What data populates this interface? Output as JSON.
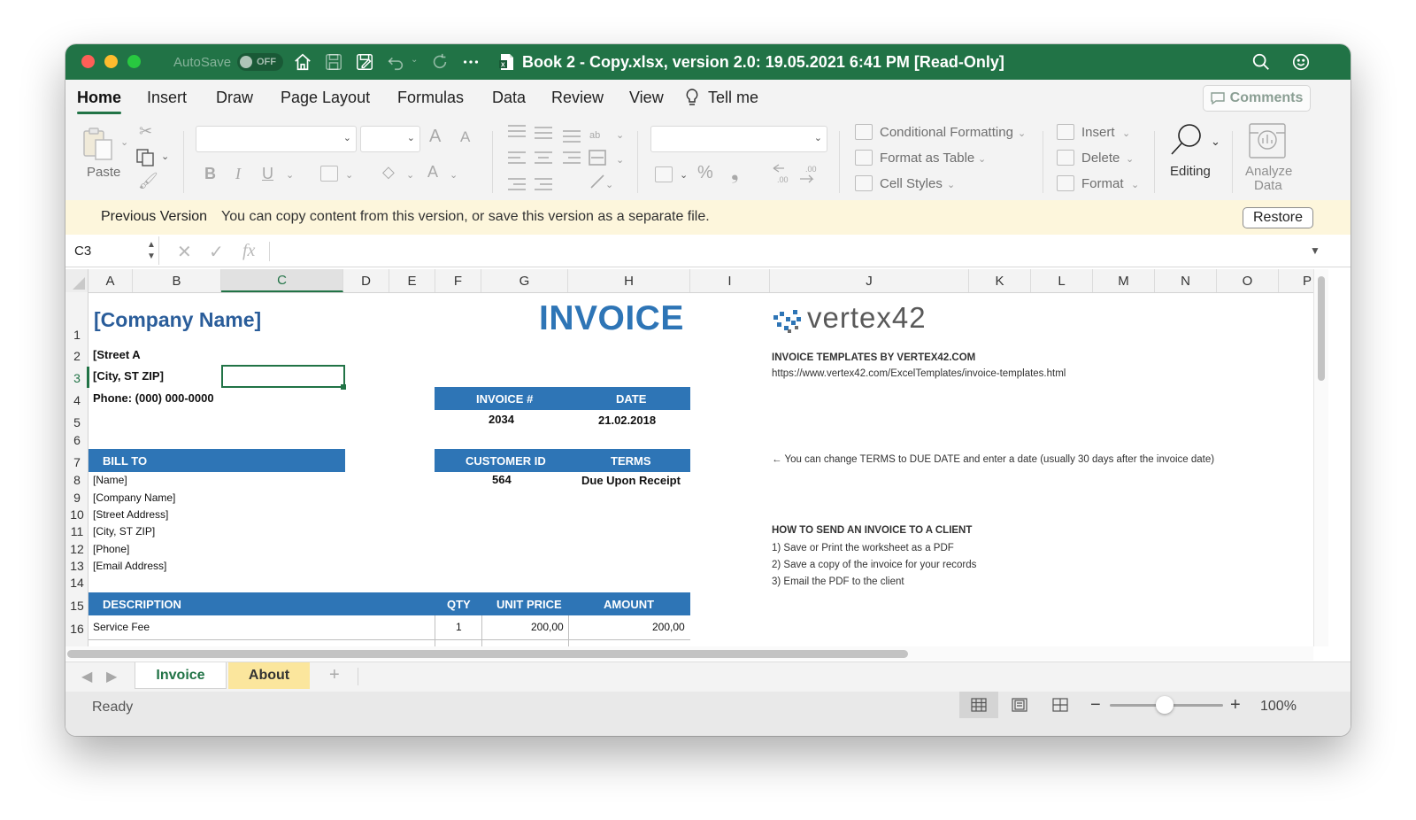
{
  "titlebar": {
    "autosave_label": "AutoSave",
    "autosave_state": "OFF",
    "title": "Book 2 - Copy.xlsx, version 2.0: 19.05.2021 6:41 PM  [Read-Only]"
  },
  "tabs": [
    "Home",
    "Insert",
    "Draw",
    "Page Layout",
    "Formulas",
    "Data",
    "Review",
    "View"
  ],
  "tell_me": "Tell me",
  "comments_label": "Comments",
  "ribbon": {
    "paste": "Paste",
    "conditional_formatting": "Conditional Formatting",
    "format_as_table": "Format as Table",
    "cell_styles": "Cell Styles",
    "insert": "Insert",
    "delete": "Delete",
    "format": "Format",
    "editing": "Editing",
    "analyze_data_1": "Analyze",
    "analyze_data_2": "Data",
    "font_increase": "A",
    "font_decrease": "A",
    "bold": "B",
    "italic": "I",
    "underline": "U",
    "percent": "%",
    "comma": "❟",
    "font_color": "A"
  },
  "message_bar": {
    "title": "Previous Version",
    "text": "You can copy content from this version, or save this version as a separate file.",
    "restore": "Restore"
  },
  "formula_bar": {
    "name_box": "C3",
    "formula": ""
  },
  "columns": [
    "A",
    "B",
    "C",
    "D",
    "E",
    "F",
    "G",
    "H",
    "I",
    "J",
    "K",
    "L",
    "M",
    "N",
    "O",
    "P"
  ],
  "rows": [
    "1",
    "2",
    "3",
    "4",
    "5",
    "6",
    "7",
    "8",
    "9",
    "10",
    "11",
    "12",
    "13",
    "14",
    "15",
    "16"
  ],
  "sheet": {
    "company_name": "[Company Name]",
    "street": "[Street A",
    "city": "[City, ST  ZIP]",
    "phone": "Phone: (000) 000-0000",
    "invoice_title": "INVOICE",
    "invoice_no_label": "INVOICE #",
    "date_label": "DATE",
    "invoice_no": "2034",
    "date": "21.02.2018",
    "bill_to": "BILL TO",
    "customer_id_label": "CUSTOMER ID",
    "terms_label": "TERMS",
    "customer_id": "564",
    "terms": "Due Upon Receipt",
    "bill_name": "[Name]",
    "bill_company": "[Company Name]",
    "bill_street": "[Street Address]",
    "bill_city": "[City, ST  ZIP]",
    "bill_phone": "[Phone]",
    "bill_email": "[Email Address]",
    "desc_label": "DESCRIPTION",
    "qty_label": "QTY",
    "unit_price_label": "UNIT PRICE",
    "amount_label": "AMOUNT",
    "item_desc": "Service Fee",
    "item_qty": "1",
    "item_unit_price": "200,00",
    "item_amount": "200,00",
    "logo_text": "vertex42",
    "templates_heading": "INVOICE TEMPLATES BY VERTEX42.COM",
    "templates_url": "https://www.vertex42.com/ExcelTemplates/invoice-templates.html",
    "terms_note": "← You can change TERMS to DUE DATE and enter a date (usually 30 days after the invoice date)",
    "howto_heading": "HOW TO SEND AN INVOICE TO A CLIENT",
    "howto_1": "1) Save or Print the worksheet as a PDF",
    "howto_2": "2) Save a copy of the invoice for your records",
    "howto_3": "3) Email the PDF to the client"
  },
  "sheet_tabs": [
    "Invoice",
    "About"
  ],
  "status": {
    "text": "Ready",
    "zoom": "100%",
    "zoom_level_percent": 100
  },
  "colors": {
    "excel_green": "#217346",
    "invoice_blue": "#2e75b6",
    "about_tab": "#fbe69d",
    "message_bar": "#fdf6dc"
  }
}
